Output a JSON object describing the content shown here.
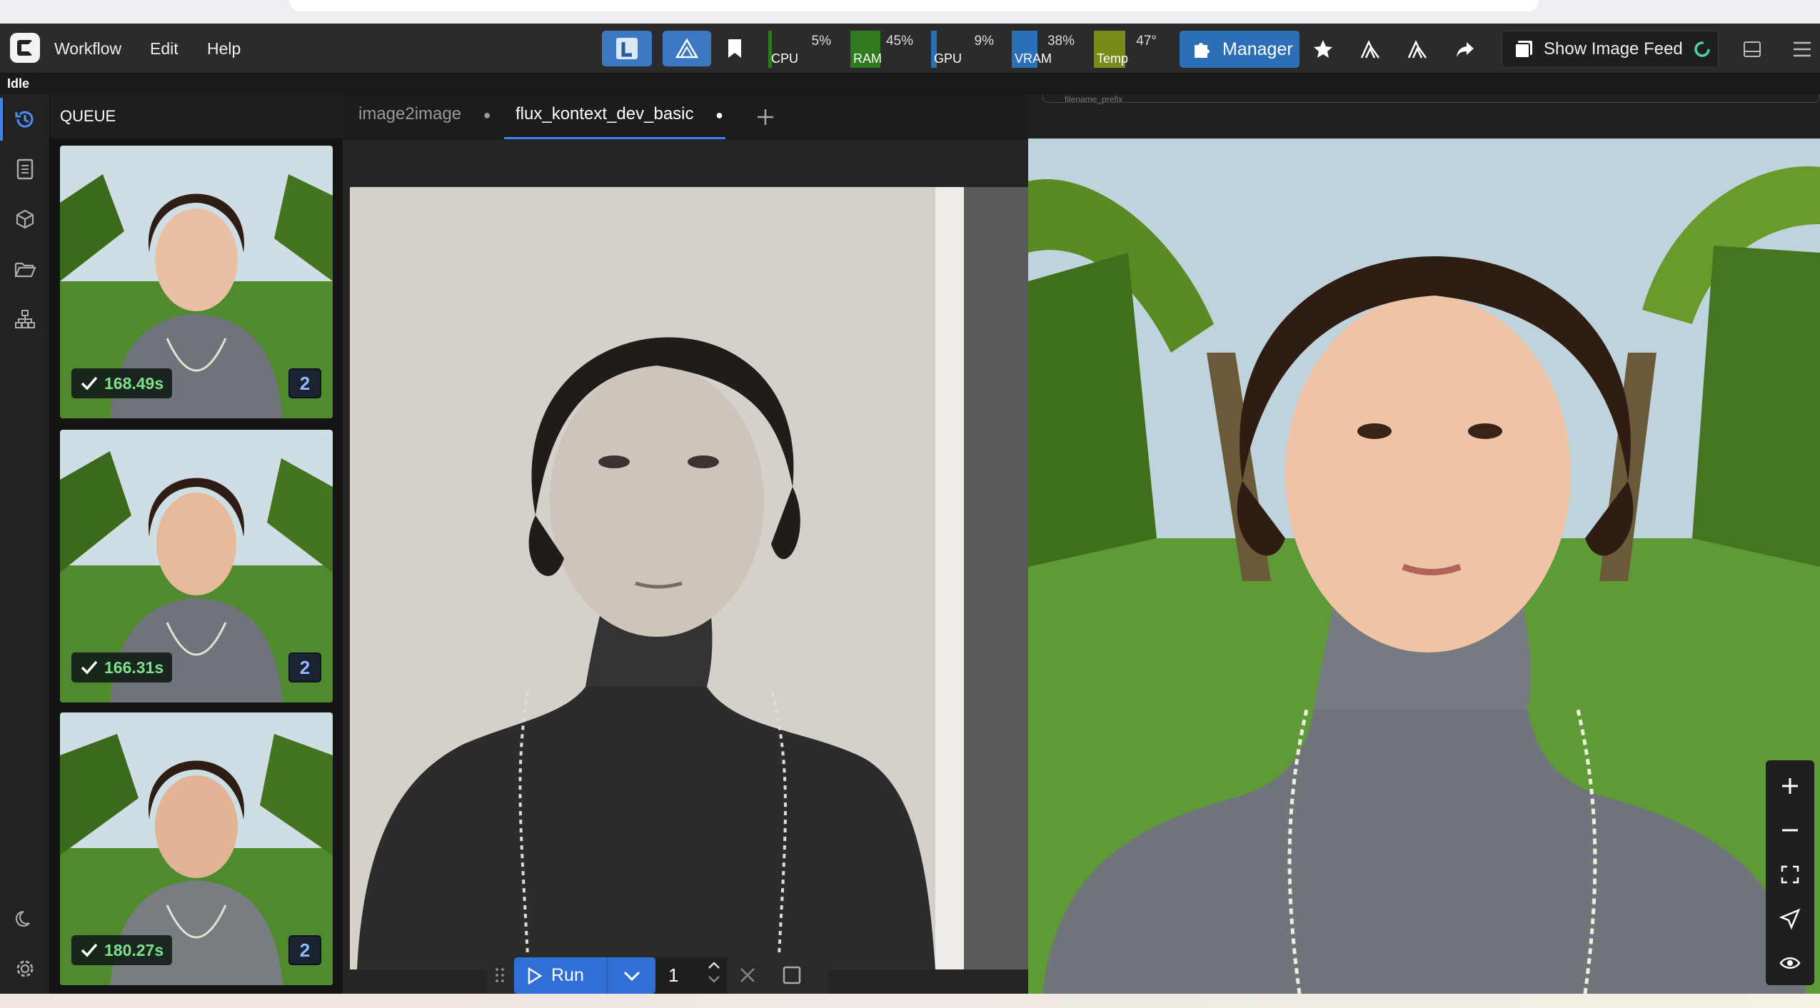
{
  "menubar": {
    "items": [
      "Workflow",
      "Edit",
      "Help"
    ],
    "stats": [
      {
        "label": "CPU",
        "percent": "5%",
        "fill": 0.05
      },
      {
        "label": "RAM",
        "percent": "45%",
        "fill": 0.45
      },
      {
        "label": "GPU",
        "percent": "9%",
        "fill": 0.09
      },
      {
        "label": "VRAM",
        "percent": "38%",
        "fill": 0.38
      },
      {
        "label": "Temp",
        "percent": "47°",
        "fill": 0.47
      }
    ],
    "manager_label": "Manager",
    "image_feed_label": "Show Image Feed"
  },
  "status": {
    "text": "Idle"
  },
  "queue": {
    "title": "QUEUE",
    "items": [
      {
        "time": "168.49s",
        "count": "2"
      },
      {
        "time": "166.31s",
        "count": "2"
      },
      {
        "time": "180.27s",
        "count": "2"
      }
    ]
  },
  "tabs": [
    {
      "label": "image2image",
      "active": false
    },
    {
      "label": "flux_kontext_dev_basic",
      "active": true
    }
  ],
  "canvas": {
    "filename_hint": "filename_prefix"
  },
  "runbar": {
    "run_label": "Run",
    "batch_count": "1"
  },
  "colors": {
    "accent": "#3b82f6",
    "success": "#7ee08a",
    "run": "#2f6fd6",
    "manager": "#2a6fb8"
  }
}
